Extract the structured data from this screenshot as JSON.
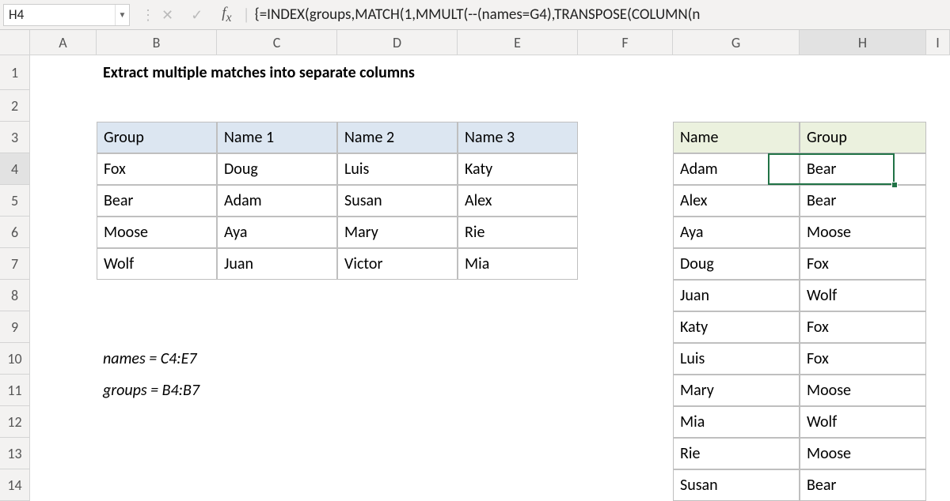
{
  "namebox": "H4",
  "formula": "{=INDEX(groups,MATCH(1,MMULT(--(names=G4),TRANSPOSE(COLUMN(n",
  "columns": [
    "A",
    "B",
    "C",
    "D",
    "E",
    "F",
    "G",
    "H",
    "I"
  ],
  "rows": [
    "1",
    "2",
    "3",
    "4",
    "5",
    "6",
    "7",
    "8",
    "9",
    "10",
    "11",
    "12",
    "13",
    "14"
  ],
  "title": "Extract multiple matches into separate columns",
  "table1": {
    "headers": [
      "Group",
      "Name 1",
      "Name 2",
      "Name 3"
    ],
    "rows": [
      [
        "Fox",
        "Doug",
        "Luis",
        "Katy"
      ],
      [
        "Bear",
        "Adam",
        "Susan",
        "Alex"
      ],
      [
        "Moose",
        "Aya",
        "Mary",
        "Rie"
      ],
      [
        "Wolf",
        "Juan",
        "Victor",
        "Mia"
      ]
    ]
  },
  "notes": {
    "names": "names = C4:E7",
    "groups": "groups = B4:B7"
  },
  "table2": {
    "headers": [
      "Name",
      "Group"
    ],
    "rows": [
      [
        "Adam",
        "Bear"
      ],
      [
        "Alex",
        "Bear"
      ],
      [
        "Aya",
        "Moose"
      ],
      [
        "Doug",
        "Fox"
      ],
      [
        "Juan",
        "Wolf"
      ],
      [
        "Katy",
        "Fox"
      ],
      [
        "Luis",
        "Fox"
      ],
      [
        "Mary",
        "Moose"
      ],
      [
        "Mia",
        "Wolf"
      ],
      [
        "Rie",
        "Moose"
      ],
      [
        "Susan",
        "Bear"
      ]
    ]
  },
  "selected_col": "H",
  "selected_row": "4"
}
